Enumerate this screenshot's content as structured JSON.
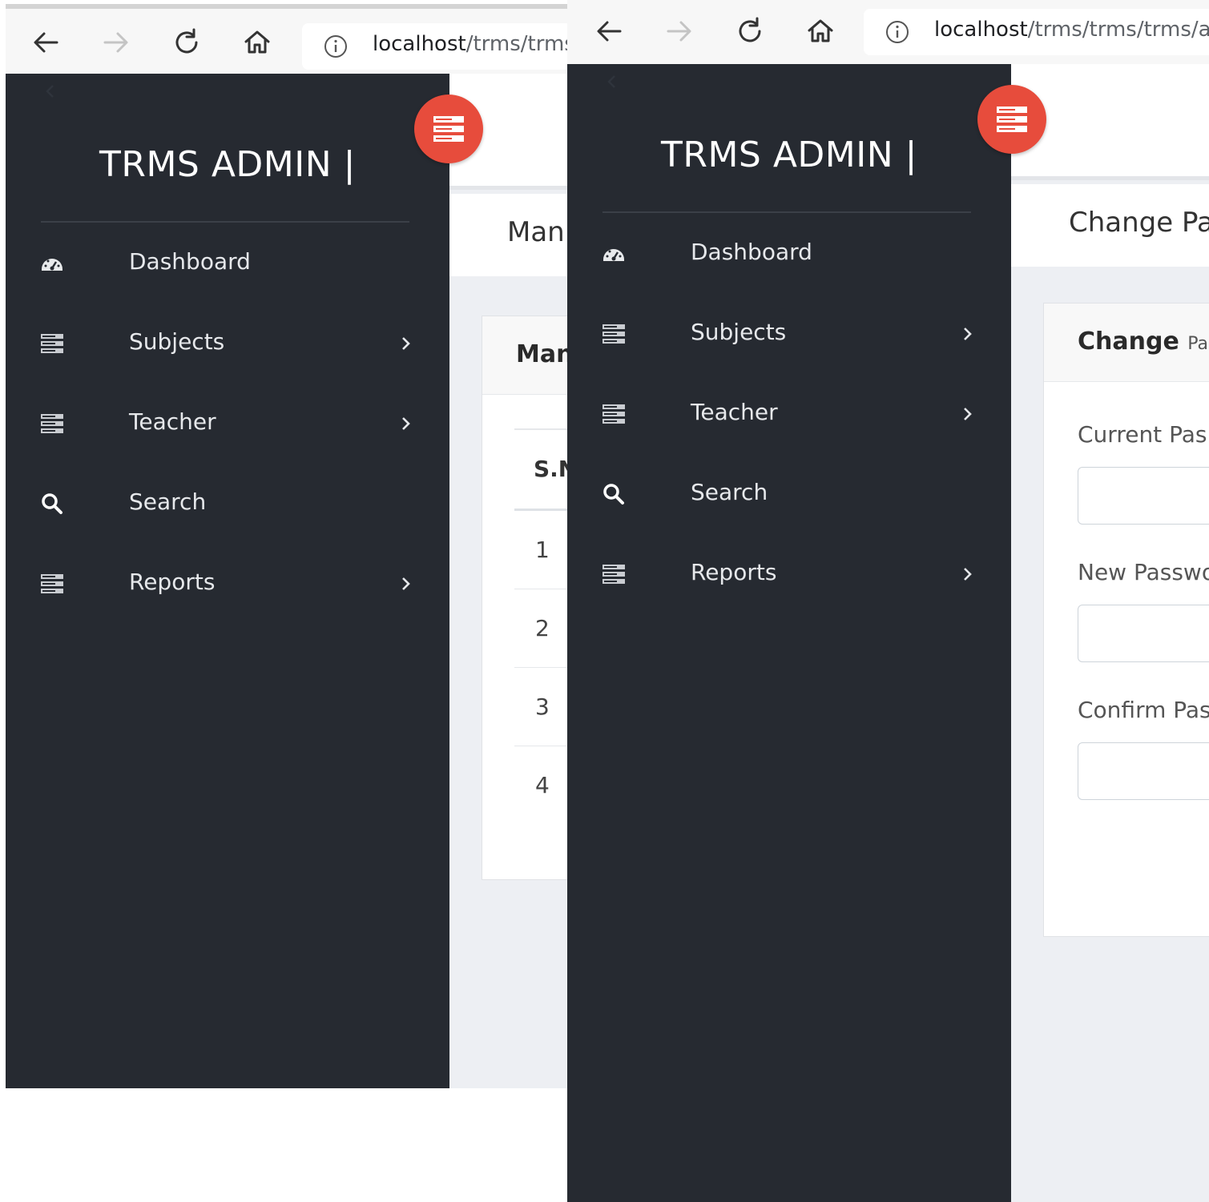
{
  "left": {
    "url_host": "localhost",
    "url_path": "/trms/trms",
    "brand": "TRMS ADMIN |",
    "menu": [
      {
        "label": "Dashboard",
        "icon": "dashboard-icon",
        "chevron": false
      },
      {
        "label": "Subjects",
        "icon": "list-icon",
        "chevron": true
      },
      {
        "label": "Teacher",
        "icon": "list-icon",
        "chevron": true
      },
      {
        "label": "Search",
        "icon": "search-icon",
        "chevron": false
      },
      {
        "label": "Reports",
        "icon": "list-icon",
        "chevron": true
      }
    ],
    "page_title": "Man",
    "card_title": "Man",
    "table": {
      "header": "S.N",
      "rows": [
        "1",
        "2",
        "3",
        "4"
      ]
    }
  },
  "right": {
    "url_host": "localhost",
    "url_path": "/trms/trms/trms/ad",
    "brand": "TRMS ADMIN |",
    "menu": [
      {
        "label": "Dashboard",
        "icon": "dashboard-icon",
        "chevron": false
      },
      {
        "label": "Subjects",
        "icon": "list-icon",
        "chevron": true
      },
      {
        "label": "Teacher",
        "icon": "list-icon",
        "chevron": true
      },
      {
        "label": "Search",
        "icon": "search-icon",
        "chevron": false
      },
      {
        "label": "Reports",
        "icon": "list-icon",
        "chevron": true
      }
    ],
    "page_title": "Change Pas",
    "card_title": "Change",
    "card_title_sub": "Pass",
    "fields": [
      {
        "label": "Current Pas",
        "value": ""
      },
      {
        "label": "New Passwo",
        "value": ""
      },
      {
        "label": "Confirm Pas",
        "value": ""
      }
    ]
  },
  "colors": {
    "sidebar": "#262a31",
    "accent": "#e74c3c",
    "content_bg": "#edeff3"
  }
}
